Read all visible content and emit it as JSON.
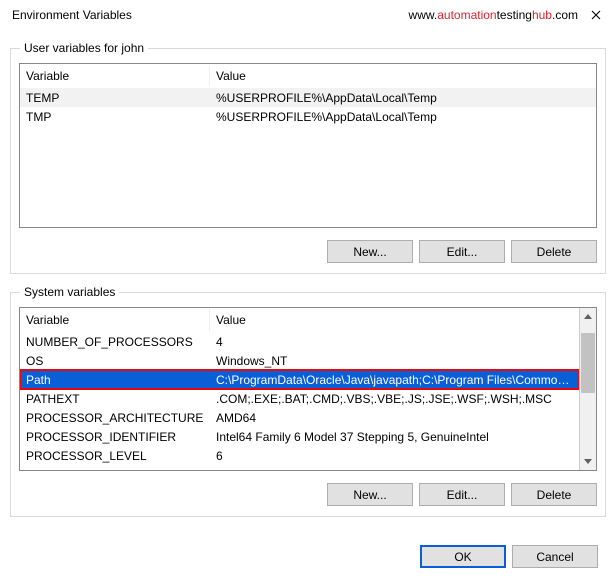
{
  "window": {
    "title": "Environment Variables",
    "watermark_prefix": "www.",
    "watermark_mid1": "automation",
    "watermark_mid2": "testing",
    "watermark_mid3": "hub",
    "watermark_suffix": ".com"
  },
  "user_section": {
    "legend": "User variables for john",
    "header_variable": "Variable",
    "header_value": "Value",
    "rows": [
      {
        "variable": "TEMP",
        "value": "%USERPROFILE%\\AppData\\Local\\Temp"
      },
      {
        "variable": "TMP",
        "value": "%USERPROFILE%\\AppData\\Local\\Temp"
      }
    ],
    "buttons": {
      "new": "New...",
      "edit": "Edit...",
      "delete": "Delete"
    }
  },
  "system_section": {
    "legend": "System variables",
    "header_variable": "Variable",
    "header_value": "Value",
    "rows": [
      {
        "variable": "NUMBER_OF_PROCESSORS",
        "value": "4"
      },
      {
        "variable": "OS",
        "value": "Windows_NT"
      },
      {
        "variable": "Path",
        "value": "C:\\ProgramData\\Oracle\\Java\\javapath;C:\\Program Files\\Common …",
        "selected": true
      },
      {
        "variable": "PATHEXT",
        "value": ".COM;.EXE;.BAT;.CMD;.VBS;.VBE;.JS;.JSE;.WSF;.WSH;.MSC"
      },
      {
        "variable": "PROCESSOR_ARCHITECTURE",
        "value": "AMD64"
      },
      {
        "variable": "PROCESSOR_IDENTIFIER",
        "value": "Intel64 Family 6 Model 37 Stepping 5, GenuineIntel"
      },
      {
        "variable": "PROCESSOR_LEVEL",
        "value": "6"
      }
    ],
    "buttons": {
      "new": "New...",
      "edit": "Edit...",
      "delete": "Delete"
    }
  },
  "dialog": {
    "ok": "OK",
    "cancel": "Cancel"
  }
}
